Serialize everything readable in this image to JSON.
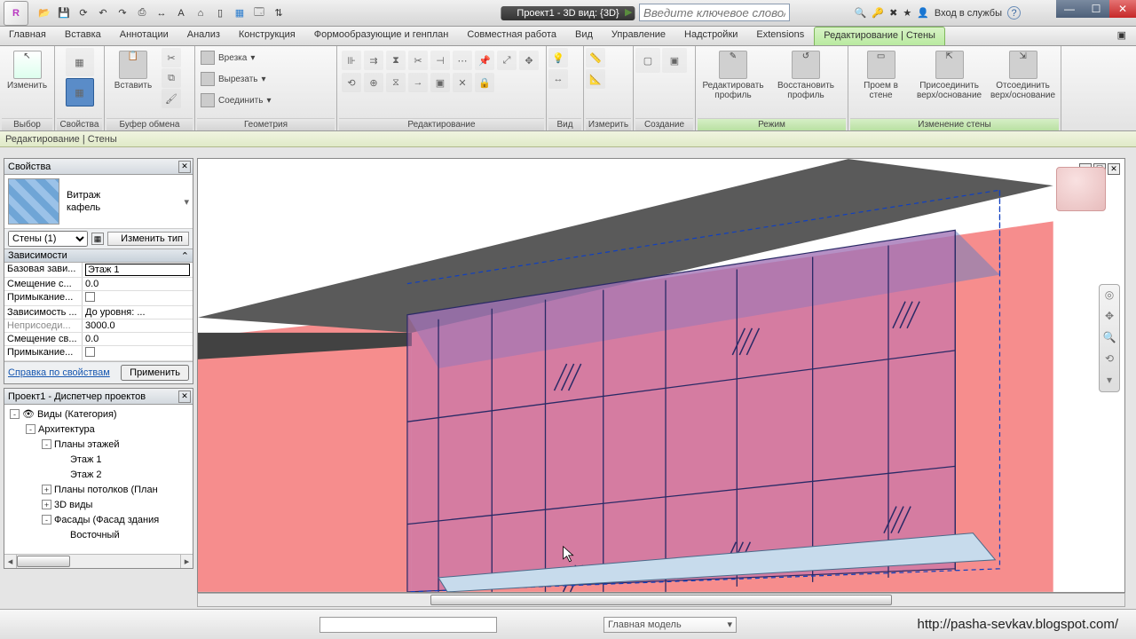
{
  "title": "Проект1 - 3D вид: {3D}",
  "search_placeholder": "Введите ключевое слово/фразу",
  "login": "Вход в службы",
  "app_letter": "R",
  "menu": [
    "Главная",
    "Вставка",
    "Аннотации",
    "Анализ",
    "Конструкция",
    "Формообразующие и генплан",
    "Совместная работа",
    "Вид",
    "Управление",
    "Надстройки",
    "Extensions"
  ],
  "menu_active": "Редактирование | Стены",
  "modebar": "Редактирование | Стены",
  "panels": {
    "p0": {
      "big": "Изменить",
      "title": "Выбор"
    },
    "p1": {
      "big": "",
      "title": "Свойства"
    },
    "p2": {
      "big": "Вставить",
      "title": "Буфер обмена"
    },
    "geom": {
      "c1": "Врезка",
      "c2": "Вырезать",
      "c3": "Соединить",
      "title": "Геометрия"
    },
    "edit_title": "Редактирование",
    "view_title": "Вид",
    "meas_title": "Измерить",
    "create_title": "Создание",
    "mode": {
      "b1": "Редактировать профиль",
      "b2": "Восстановить профиль",
      "title": "Режим"
    },
    "wall": {
      "b1": "Проем в стене",
      "b2": "Присоединить верх/основание",
      "b3": "Отсоединить верх/основание",
      "title": "Изменение стены"
    }
  },
  "props": {
    "palette_title": "Свойства",
    "type_line1": "Витраж",
    "type_line2": "кафель",
    "instance": "Стены (1)",
    "edit_type": "Изменить тип",
    "group": "Зависимости",
    "rows": [
      {
        "k": "Базовая зави...",
        "v": "Этаж 1",
        "editable": true
      },
      {
        "k": "Смещение с...",
        "v": "0.0"
      },
      {
        "k": "Примыкание...",
        "v": "",
        "check": true
      },
      {
        "k": "Зависимость ...",
        "v": "До уровня: ..."
      },
      {
        "k": "Неприсоеди...",
        "v": "3000.0",
        "dis": true
      },
      {
        "k": "Смещение св...",
        "v": "0.0"
      },
      {
        "k": "Примыкание...",
        "v": "",
        "check": true
      }
    ],
    "help": "Справка по свойствам",
    "apply": "Применить"
  },
  "browser": {
    "title": "Проект1 - Диспетчер проектов",
    "items": [
      {
        "t": "Виды (Категория)",
        "ind": 0,
        "tw": "-",
        "icon": true
      },
      {
        "t": "Архитектура",
        "ind": 1,
        "tw": "-"
      },
      {
        "t": "Планы этажей",
        "ind": 2,
        "tw": "-"
      },
      {
        "t": "Этаж 1",
        "ind": 3
      },
      {
        "t": "Этаж 2",
        "ind": 3
      },
      {
        "t": "Планы потолков (План",
        "ind": 2,
        "tw": "+"
      },
      {
        "t": "3D виды",
        "ind": 2,
        "tw": "+"
      },
      {
        "t": "Фасады (Фасад здания",
        "ind": 2,
        "tw": "-"
      },
      {
        "t": "Восточный",
        "ind": 3
      }
    ]
  },
  "status_combo": "Главная модель",
  "url": "http://pasha-sevkav.blogspot.com/"
}
